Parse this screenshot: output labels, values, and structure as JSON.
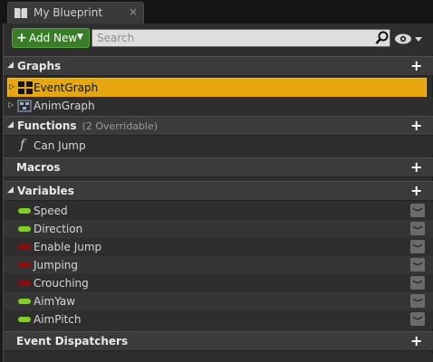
{
  "tab": {
    "title": "My Blueprint",
    "close": "×"
  },
  "toolbar": {
    "add_plus": "+",
    "add_label": "Add New",
    "add_caret": "▼",
    "search_placeholder": "Search"
  },
  "sections": {
    "graphs": {
      "title": "Graphs"
    },
    "functions": {
      "title": "Functions",
      "subtitle": "(2 Overridable)"
    },
    "macros": {
      "title": "Macros"
    },
    "variables": {
      "title": "Variables"
    },
    "dispatchers": {
      "title": "Event Dispatchers"
    }
  },
  "graphs": [
    {
      "label": "EventGraph",
      "selected": true
    },
    {
      "label": "AnimGraph",
      "selected": false
    }
  ],
  "functions": [
    {
      "label": "Can Jump"
    }
  ],
  "variables": [
    {
      "label": "Speed",
      "type": "bool",
      "color": "#7fd024"
    },
    {
      "label": "Direction",
      "type": "bool",
      "color": "#7fd024"
    },
    {
      "label": "Enable Jump",
      "type": "bool",
      "color": "#8a0e0e"
    },
    {
      "label": "Jumping",
      "type": "bool",
      "color": "#8a0e0e"
    },
    {
      "label": "Crouching",
      "type": "bool",
      "color": "#8a0e0e"
    },
    {
      "label": "AimYaw",
      "type": "bool",
      "color": "#7fd024"
    },
    {
      "label": "AimPitch",
      "type": "bool",
      "color": "#7fd024"
    }
  ],
  "colors": {
    "accent_selected": "#e5a70d",
    "add_button": "#3a7d29",
    "float_var": "#7fd024",
    "bool_var": "#8a0e0e"
  },
  "icons": {
    "tab": "book-icon",
    "search": "magnifier-icon",
    "visibility": "eye-icon",
    "graph": "graph-icon",
    "function": "function-icon"
  }
}
